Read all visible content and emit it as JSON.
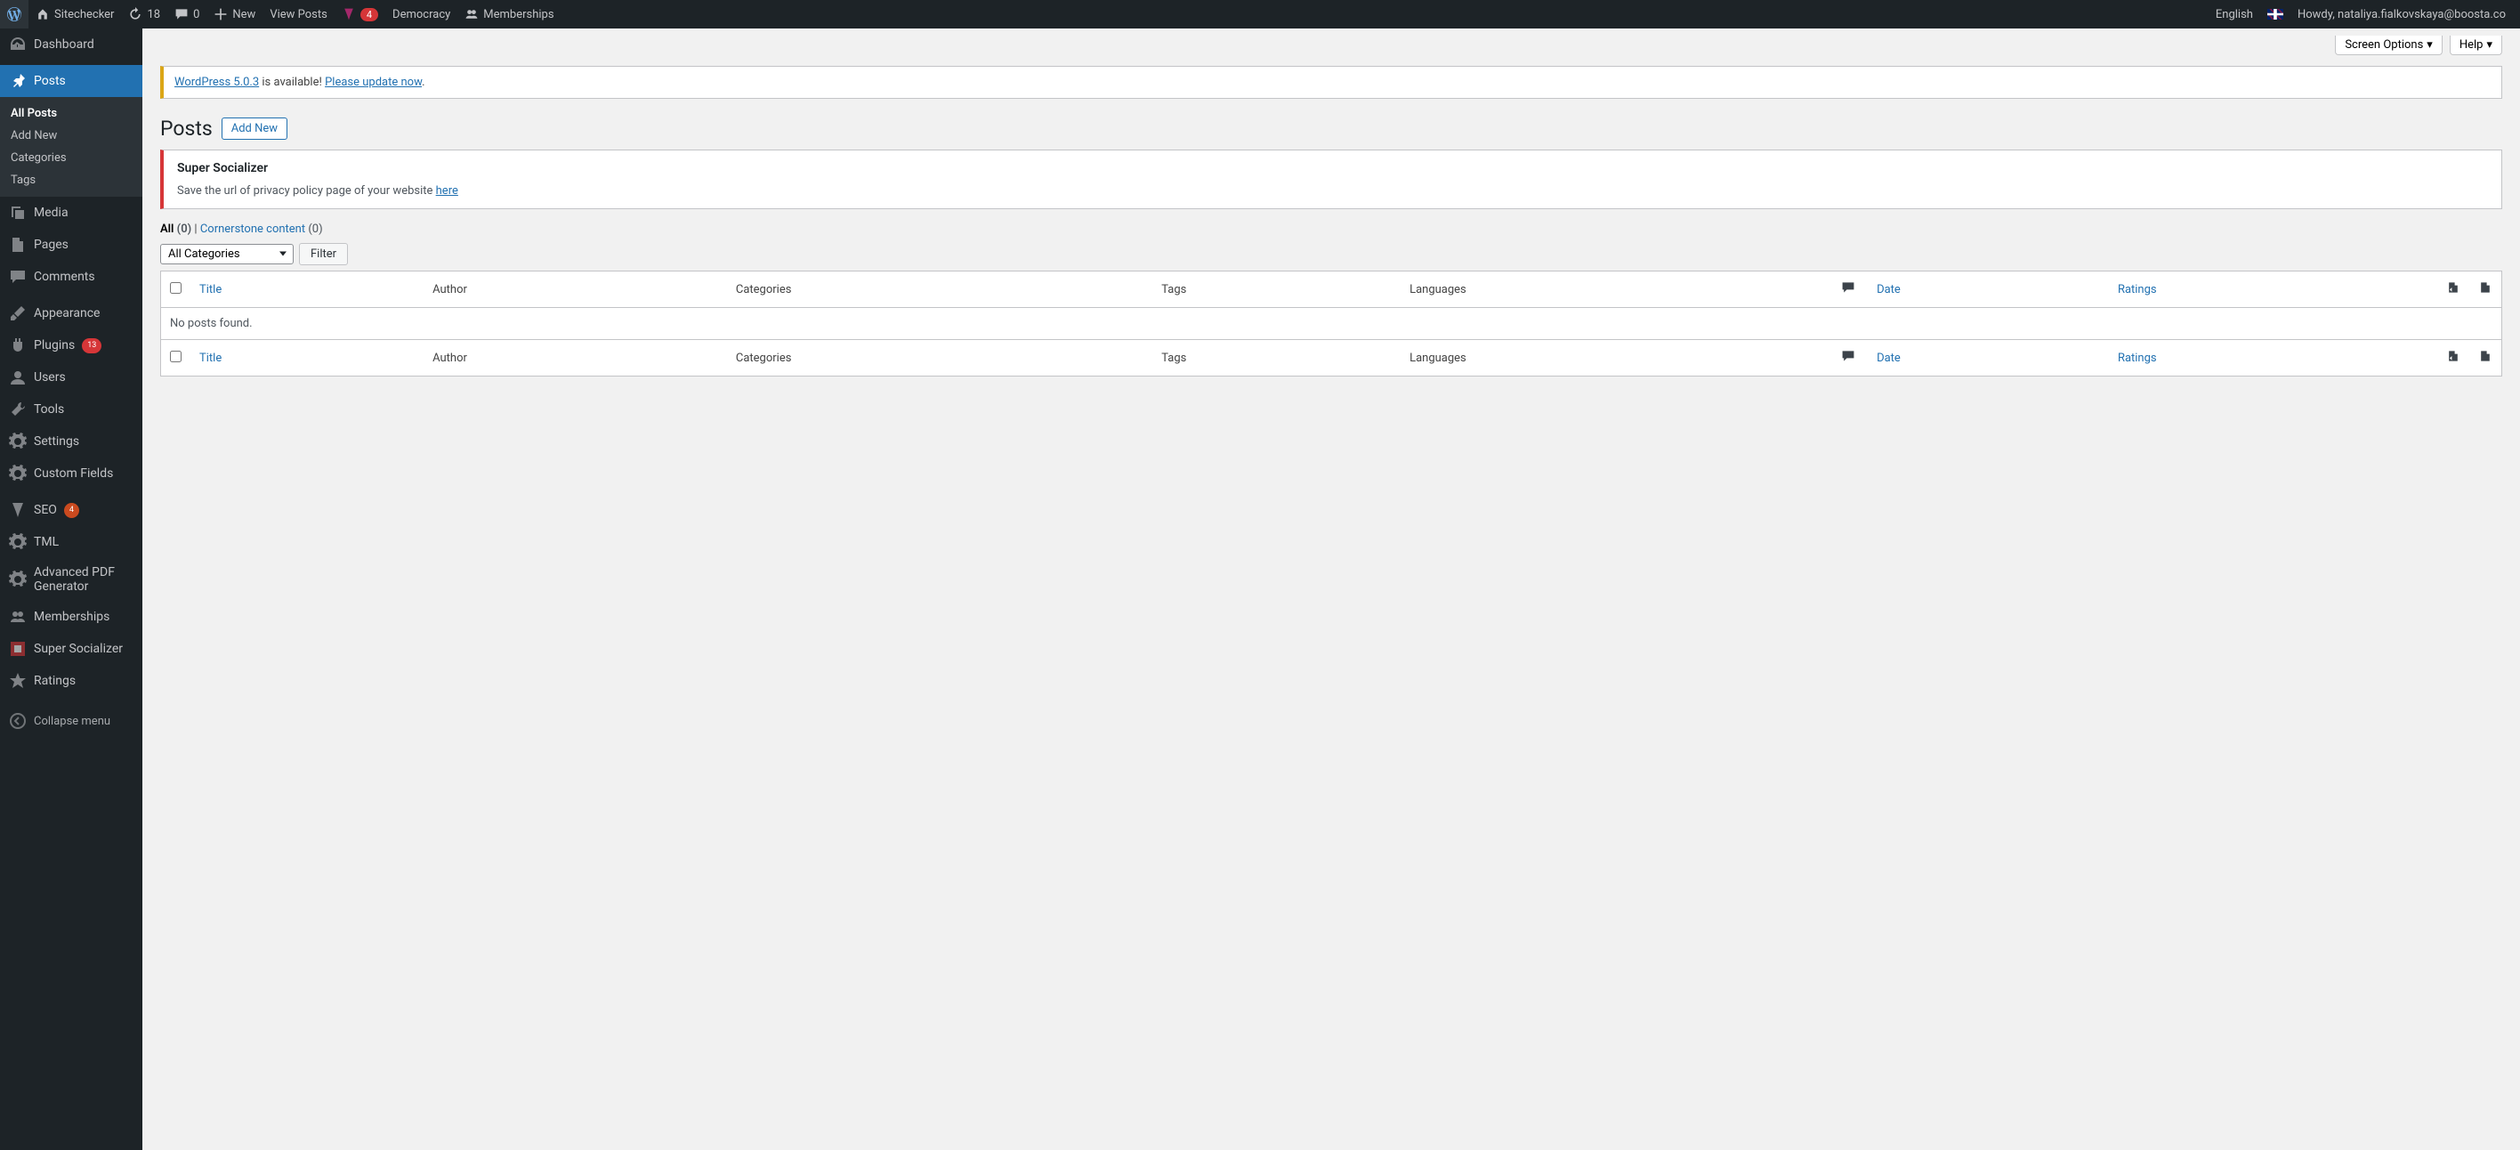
{
  "adminbar": {
    "site_name": "Sitechecker",
    "updates_count": "18",
    "comments_count": "0",
    "new_label": "New",
    "view_posts": "View Posts",
    "yoast_count": "4",
    "democracy": "Democracy",
    "memberships": "Memberships",
    "language": "English",
    "howdy": "Howdy, nataliya.fialkovskaya@boosta.co"
  },
  "sidebar": {
    "dashboard": "Dashboard",
    "posts": "Posts",
    "submenu": {
      "all_posts": "All Posts",
      "add_new": "Add New",
      "categories": "Categories",
      "tags": "Tags"
    },
    "media": "Media",
    "pages": "Pages",
    "comments": "Comments",
    "appearance": "Appearance",
    "plugins": "Plugins",
    "plugins_badge": "13",
    "users": "Users",
    "tools": "Tools",
    "settings": "Settings",
    "custom_fields": "Custom Fields",
    "seo": "SEO",
    "seo_badge": "4",
    "tml": "TML",
    "pdf": "Advanced PDF Generator",
    "memberships": "Memberships",
    "socializer": "Super Socializer",
    "ratings": "Ratings",
    "collapse": "Collapse menu"
  },
  "top_actions": {
    "screen_options": "Screen Options",
    "help": "Help"
  },
  "update_notice": {
    "link1": "WordPress 5.0.3",
    "mid": " is available! ",
    "link2": "Please update now",
    "end": "."
  },
  "heading": {
    "title": "Posts",
    "add_new": "Add New"
  },
  "socializer_notice": {
    "title": "Super Socializer",
    "text": "Save the url of privacy policy page of your website ",
    "link": "here"
  },
  "filters": {
    "all": "All",
    "all_count": "(0)",
    "sep": "  |  ",
    "cornerstone": "Cornerstone content",
    "cornerstone_count": "(0)"
  },
  "tablenav": {
    "all_categories": "All Categories",
    "filter": "Filter"
  },
  "table": {
    "title": "Title",
    "author": "Author",
    "categories": "Categories",
    "tags": "Tags",
    "languages": "Languages",
    "date": "Date",
    "ratings": "Ratings",
    "no_posts": "No posts found."
  }
}
